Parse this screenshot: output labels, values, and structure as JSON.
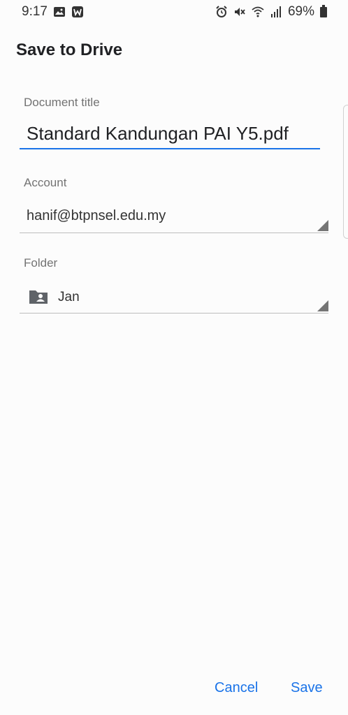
{
  "status_bar": {
    "time": "9:17",
    "battery": "69%",
    "icons_left": [
      "image-icon",
      "app-w-icon"
    ],
    "icons_right": [
      "alarm-icon",
      "mute-icon",
      "wifi-icon",
      "signal-icon",
      "battery-icon"
    ]
  },
  "dialog": {
    "title": "Save to Drive",
    "document_title_label": "Document title",
    "document_title_value": "Standard Kandungan PAI Y5.pdf",
    "account_label": "Account",
    "account_value": "hanif@btpnsel.edu.my",
    "folder_label": "Folder",
    "folder_value": "Jan",
    "cancel_label": "Cancel",
    "save_label": "Save"
  },
  "colors": {
    "accent": "#1a73e8",
    "label": "#737373",
    "background": "#fcfcfc"
  }
}
